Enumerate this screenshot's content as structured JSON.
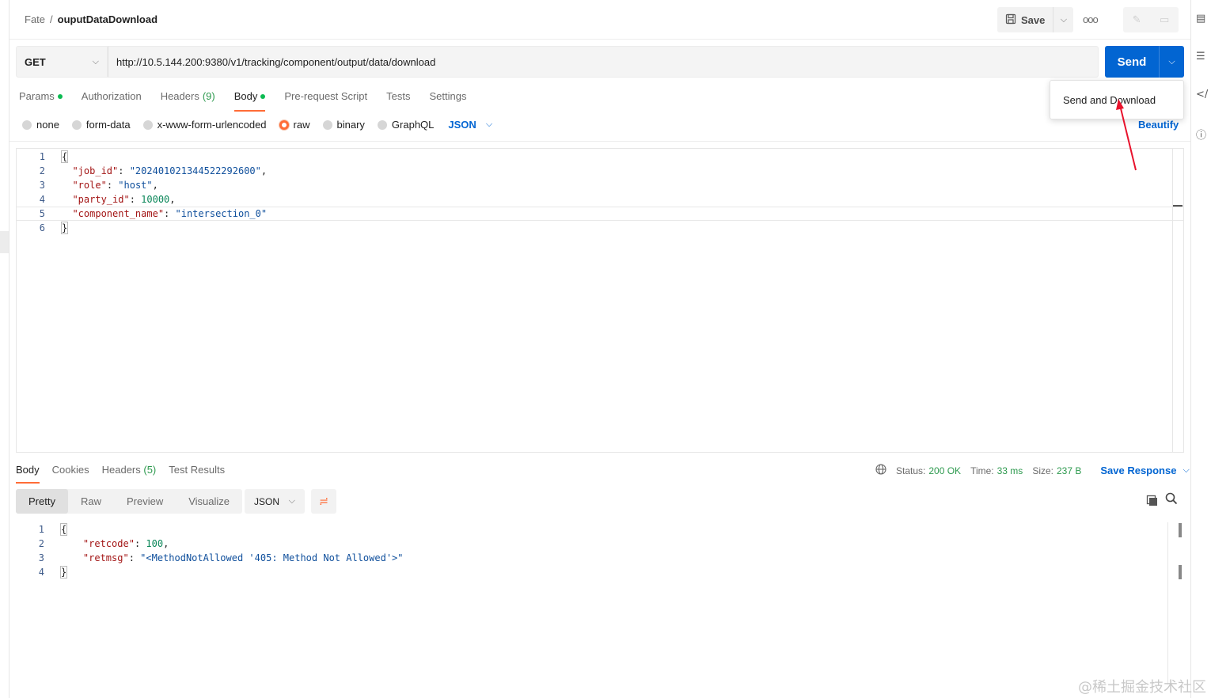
{
  "breadcrumb": {
    "parent": "Fate",
    "separator": "/",
    "current": "ouputDataDownload"
  },
  "header": {
    "save_label": "Save",
    "more_label": "ooo"
  },
  "request": {
    "method": "GET",
    "url": "http://10.5.144.200:9380/v1/tracking/component/output/data/download",
    "send_label": "Send",
    "dropdown_item": "Send and Download"
  },
  "request_tabs": [
    {
      "label": "Params",
      "dot": true
    },
    {
      "label": "Authorization"
    },
    {
      "label": "Headers",
      "count": "(9)"
    },
    {
      "label": "Body",
      "dot": true,
      "active": true
    },
    {
      "label": "Pre-request Script"
    },
    {
      "label": "Tests"
    },
    {
      "label": "Settings"
    }
  ],
  "body_types": {
    "options": [
      "none",
      "form-data",
      "x-www-form-urlencoded",
      "raw",
      "binary",
      "GraphQL"
    ],
    "selected": "raw",
    "language": "JSON",
    "beautify_label": "Beautify"
  },
  "request_body": {
    "line_numbers": [
      "1",
      "2",
      "3",
      "4",
      "5",
      "6"
    ],
    "open_brace": "{",
    "close_brace": "}",
    "fields": [
      {
        "key": "\"job_id\"",
        "value": "\"202401021344522292600\"",
        "trail": ","
      },
      {
        "key": "\"role\"",
        "value": "\"host\"",
        "trail": ","
      },
      {
        "key": "\"party_id\"",
        "value": "10000",
        "trail": ","
      },
      {
        "key": "\"component_name\"",
        "value": "\"intersection_0\"",
        "trail": ""
      }
    ]
  },
  "response_tabs": [
    {
      "label": "Body",
      "active": true
    },
    {
      "label": "Cookies"
    },
    {
      "label": "Headers",
      "count": "(5)"
    },
    {
      "label": "Test Results"
    }
  ],
  "response_meta": {
    "status_label": "Status:",
    "status_value": "200 OK",
    "time_label": "Time:",
    "time_value": "33 ms",
    "size_label": "Size:",
    "size_value": "237 B",
    "save_response_label": "Save Response"
  },
  "view_modes": [
    "Pretty",
    "Raw",
    "Preview",
    "Visualize"
  ],
  "response_format": "JSON",
  "response_body": {
    "line_numbers": [
      "1",
      "2",
      "3",
      "4"
    ],
    "open_brace": "{",
    "close_brace": "}",
    "fields": [
      {
        "key": "\"retcode\"",
        "value": "100",
        "trail": ","
      },
      {
        "key": "\"retmsg\"",
        "value": "\"<MethodNotAllowed '405: Method Not Allowed'>\"",
        "trail": ""
      }
    ]
  },
  "watermark": "@稀土掘金技术社区",
  "colors": {
    "accent": "#ff6c37",
    "primary": "#0265d2",
    "success": "#2e9a4f",
    "annotation_arrow": "#e8132d"
  },
  "icons": [
    "save-icon",
    "chevron-down-icon",
    "more-icon",
    "edit-icon",
    "comment-icon",
    "globe-icon",
    "copy-icon",
    "search-icon",
    "wrap-icon"
  ]
}
